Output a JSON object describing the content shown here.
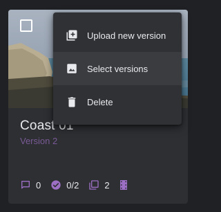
{
  "card": {
    "title": "Coast 01",
    "subtitle": "Version 2",
    "stats": {
      "comments": "0",
      "approvals": "0/2",
      "versions": "2"
    }
  },
  "menu": {
    "items": [
      {
        "label": "Upload new version",
        "icon": "upload-version-icon"
      },
      {
        "label": "Select versions",
        "icon": "image-icon"
      },
      {
        "label": "Delete",
        "icon": "trash-icon"
      }
    ]
  },
  "colors": {
    "accent": "#9c6fc4",
    "subtitle": "#7a5a96",
    "card_bg": "#2d2f33",
    "menu_bg": "#2f3135",
    "menu_hover": "#3a3c40"
  }
}
